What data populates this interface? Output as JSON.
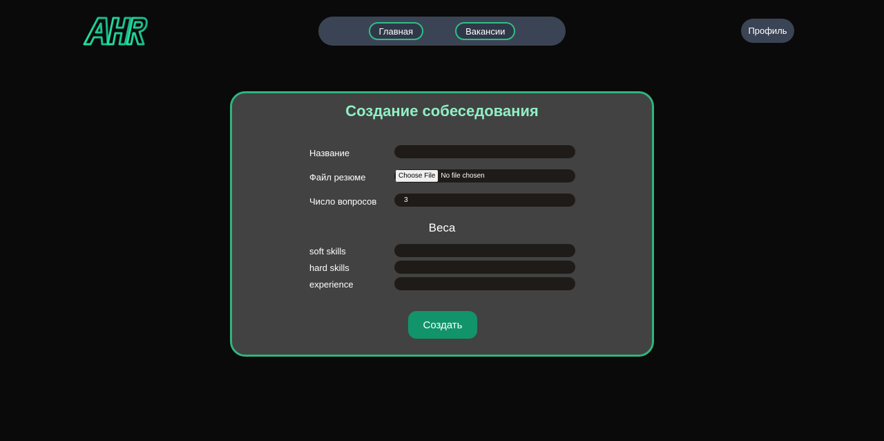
{
  "app": {
    "logo_text": "AHR"
  },
  "nav": {
    "items": [
      {
        "label": "Главная"
      },
      {
        "label": "Вакансии"
      }
    ],
    "profile_label": "Профиль"
  },
  "form": {
    "title": "Создание собеседования",
    "fields": {
      "name": {
        "label": "Название",
        "value": ""
      },
      "resume": {
        "label": "Файл резюме",
        "button": "Choose File",
        "status": "No file chosen"
      },
      "questions": {
        "label": "Число вопросов",
        "value": "3"
      }
    },
    "weights": {
      "title": "Веса",
      "items": [
        {
          "label": "soft skills",
          "value": ""
        },
        {
          "label": "hard skills",
          "value": ""
        },
        {
          "label": "experience",
          "value": ""
        }
      ]
    },
    "submit_label": "Создать"
  },
  "colors": {
    "accent": "#2fb57f",
    "title": "#8ff0c5",
    "button": "#12946b",
    "card": "#424242",
    "background": "#0a0a0a",
    "nav": "#3b4455"
  }
}
